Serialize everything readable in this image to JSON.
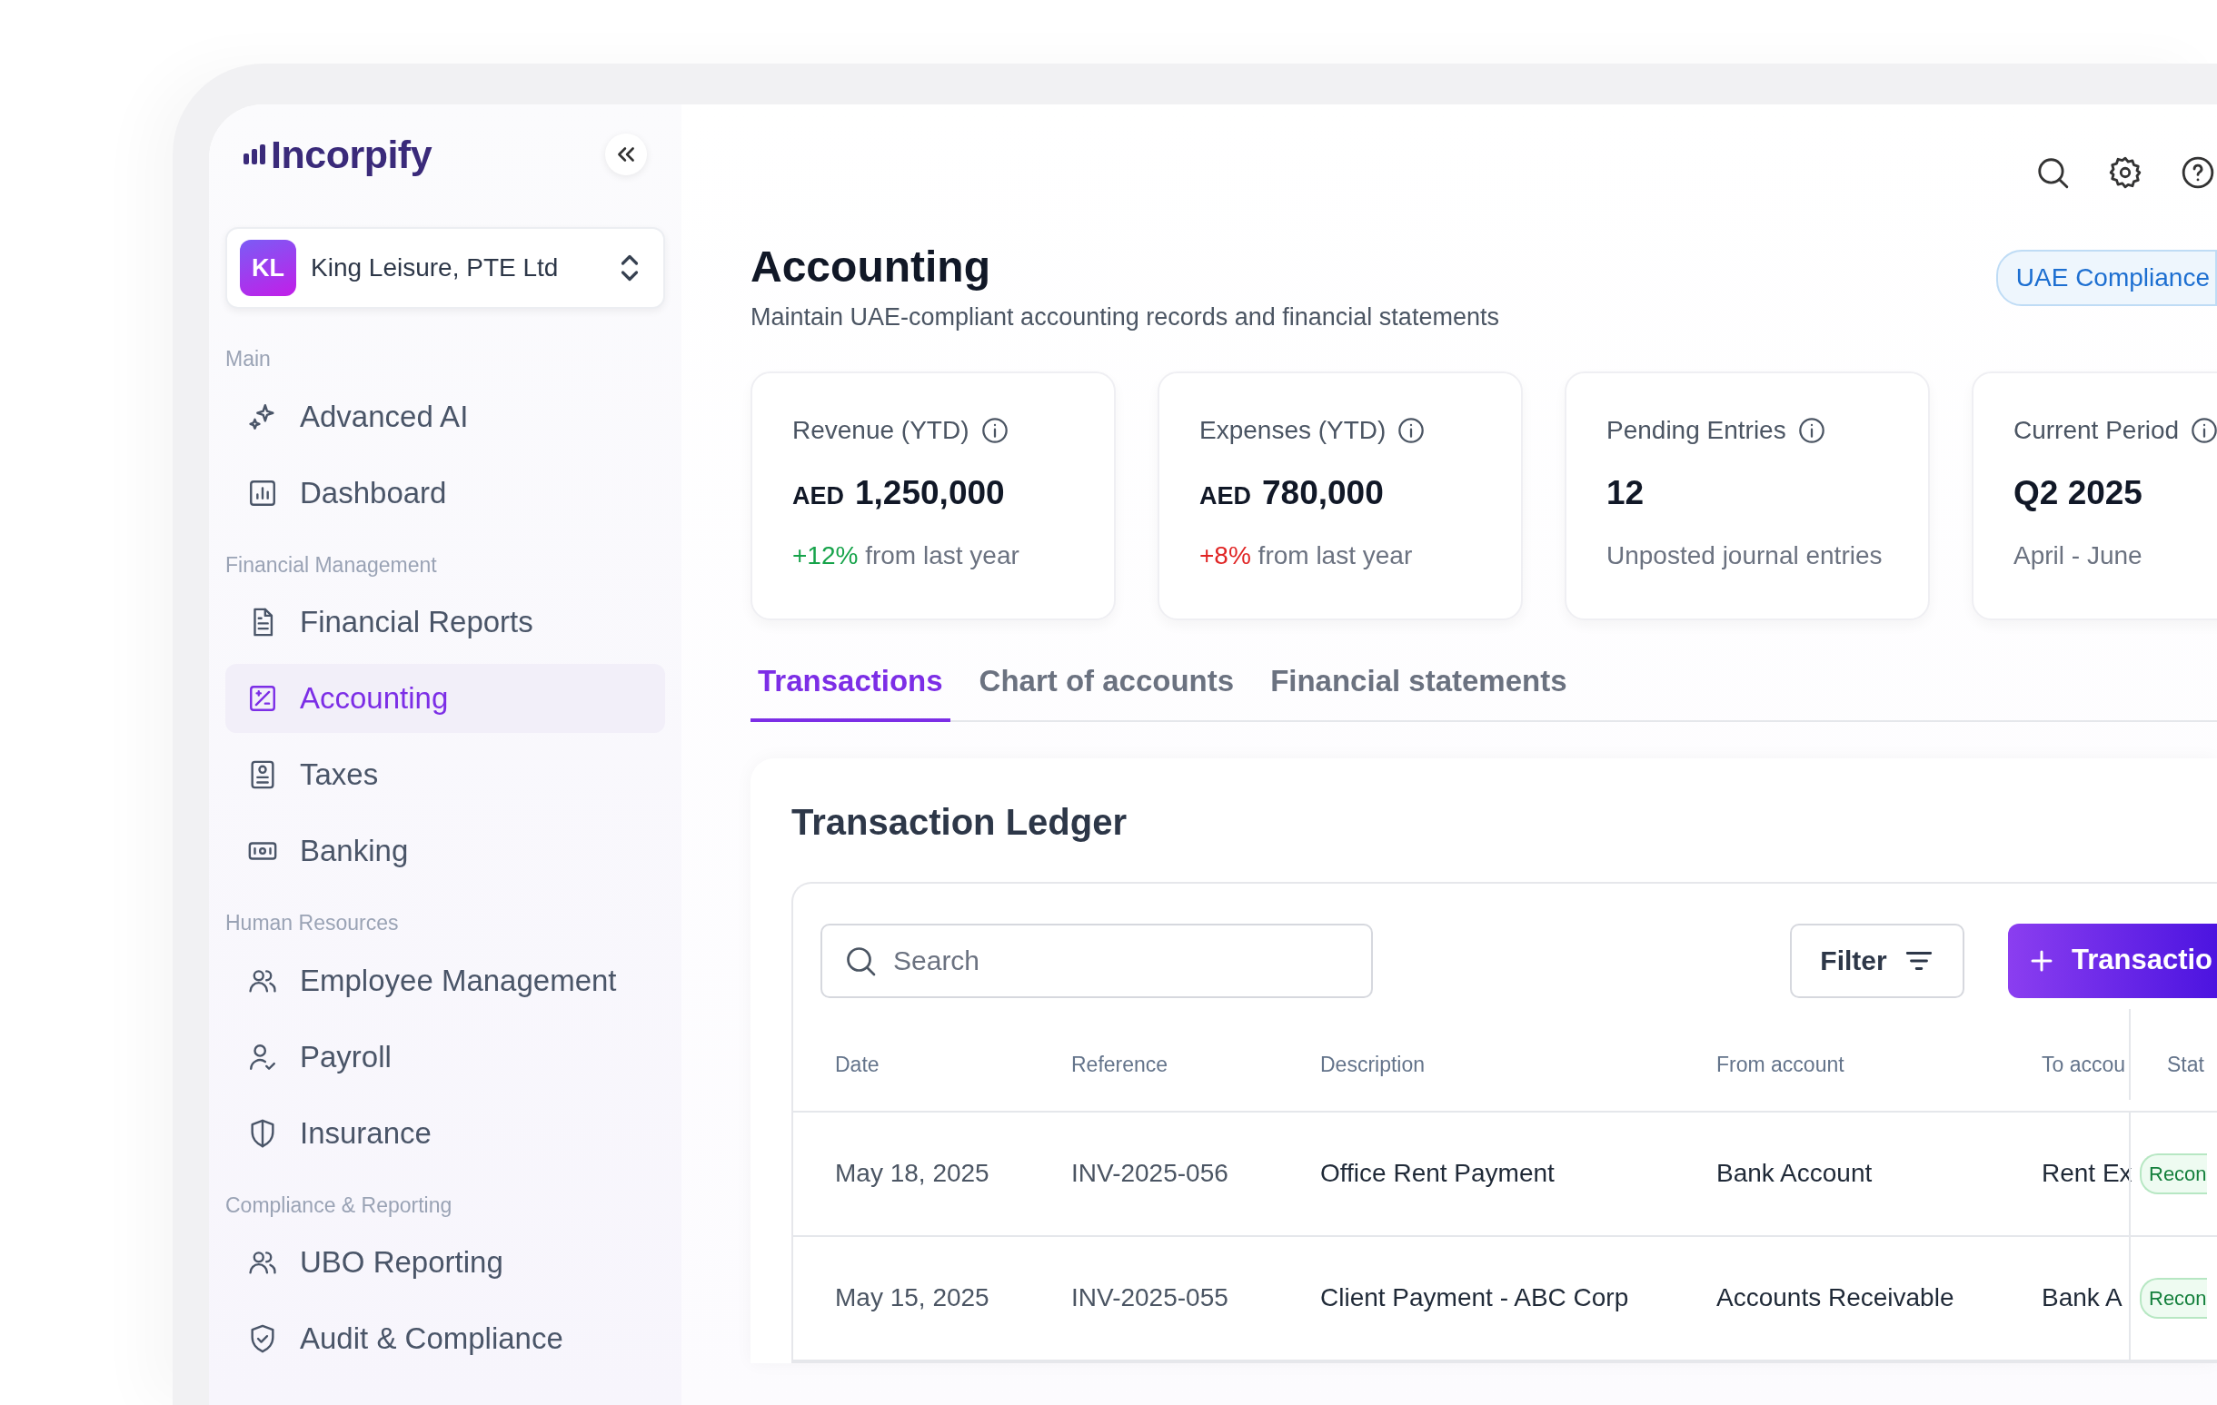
{
  "brand": {
    "name": "Incorpify"
  },
  "org": {
    "initials": "KL",
    "name": "King Leisure, PTE Ltd"
  },
  "sidebar": {
    "sections": [
      {
        "title": "Main",
        "items": [
          {
            "label": "Advanced AI",
            "selected": false
          },
          {
            "label": "Dashboard",
            "selected": false
          }
        ]
      },
      {
        "title": "Financial Management",
        "items": [
          {
            "label": "Financial Reports",
            "selected": false
          },
          {
            "label": "Accounting",
            "selected": true
          },
          {
            "label": "Taxes",
            "selected": false
          },
          {
            "label": "Banking",
            "selected": false
          }
        ]
      },
      {
        "title": "Human Resources",
        "items": [
          {
            "label": "Employee Management",
            "selected": false
          },
          {
            "label": "Payroll",
            "selected": false
          },
          {
            "label": "Insurance",
            "selected": false
          }
        ]
      },
      {
        "title": "Compliance & Reporting",
        "items": [
          {
            "label": "UBO Reporting",
            "selected": false
          },
          {
            "label": "Audit & Compliance",
            "selected": false
          }
        ]
      }
    ]
  },
  "page": {
    "title": "Accounting",
    "subtitle": "Maintain UAE-compliant accounting records and financial statements",
    "badge": "UAE Compliance"
  },
  "stats": [
    {
      "label": "Revenue (YTD)",
      "currency": "AED",
      "value": "1,250,000",
      "change": "+12%",
      "color": "#16a34a",
      "note": "from last year"
    },
    {
      "label": "Expenses (YTD)",
      "currency": "AED",
      "value": "780,000",
      "change": "+8%",
      "color": "#e02424",
      "note": "from last year"
    },
    {
      "label": "Pending Entries",
      "value": "12",
      "note": "Unposted journal entries"
    },
    {
      "label": "Current Period",
      "value": "Q2 2025",
      "note": "April - June"
    }
  ],
  "tabs": [
    {
      "label": "Transactions",
      "selected": true
    },
    {
      "label": "Chart of accounts",
      "selected": false
    },
    {
      "label": "Financial statements",
      "selected": false
    }
  ],
  "ledger": {
    "title": "Transaction Ledger",
    "search": {
      "placeholder": "Search"
    },
    "filter": "Filter",
    "add": "Transactio",
    "columns": [
      "Date",
      "Reference",
      "Description",
      "From account",
      "To accou",
      "Stat"
    ],
    "rows": [
      {
        "date": "May 18, 2025",
        "reference": "INV-2025-056",
        "description": "Office Rent Payment",
        "from": "Bank Account",
        "to": "Rent Ex",
        "status": "Recon"
      },
      {
        "date": "May 15, 2025",
        "reference": "INV-2025-055",
        "description": "Client Payment - ABC Corp",
        "from": "Accounts Receivable",
        "to": "Bank A",
        "status": "Recon"
      }
    ]
  }
}
